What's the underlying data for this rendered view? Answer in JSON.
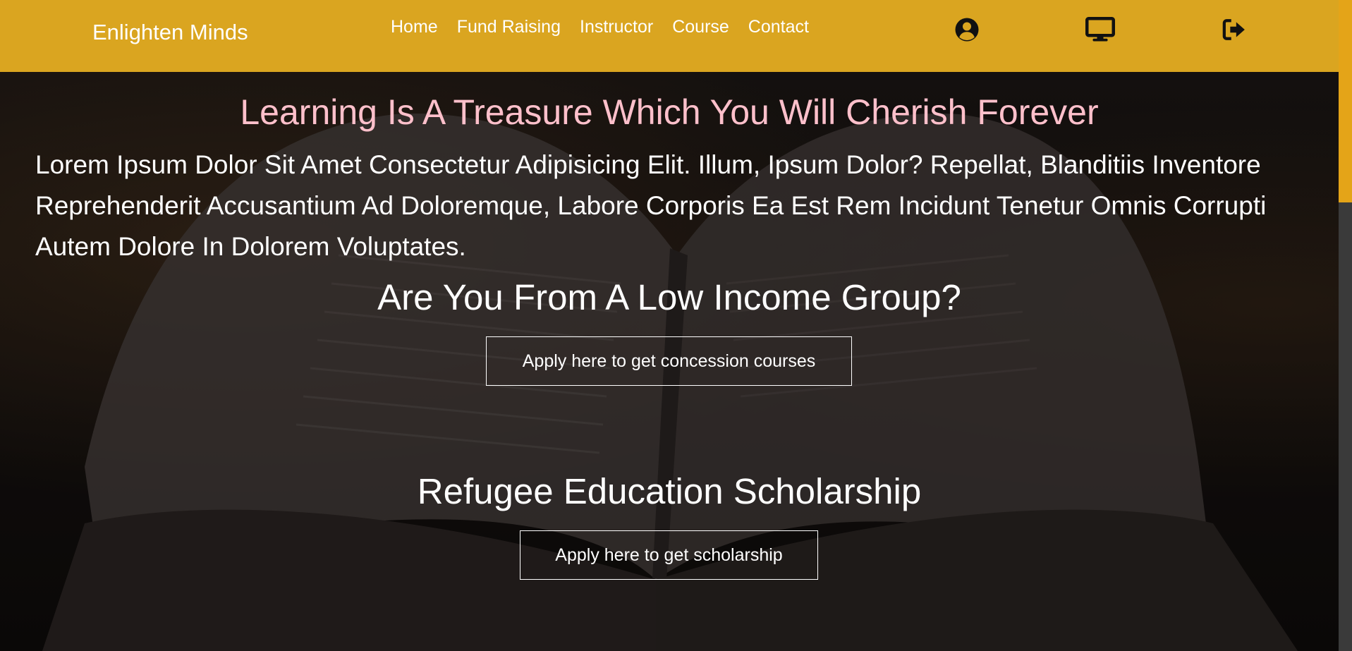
{
  "header": {
    "brand": "Enlighten Minds",
    "nav": [
      "Home",
      "Fund Raising",
      "Instructor",
      "Course",
      "Contact"
    ],
    "icons": [
      "user-circle-icon",
      "monitor-icon",
      "sign-out-icon"
    ]
  },
  "hero": {
    "headline": "Learning Is A Treasure Which You Will Cherish Forever",
    "intro": "Lorem Ipsum Dolor Sit Amet Consectetur Adipisicing Elit. Illum, Ipsum Dolor? Repellat, Blanditiis Inventore Reprehenderit Accusantium Ad Doloremque, Labore Corporis Ea Est Rem Incidunt Tenetur Omnis Corrupti Autem Dolore In Dolorem Voluptates.",
    "concession": {
      "heading": "Are You From A Low Income Group?",
      "button": "Apply here to get concession courses"
    },
    "scholarship": {
      "heading": "Refugee Education Scholarship",
      "button": "Apply here to get scholarship"
    }
  },
  "colors": {
    "header_bg": "#daa520",
    "headline": "#ffc0cb",
    "scrollbar_thumb": "#e4a418"
  }
}
